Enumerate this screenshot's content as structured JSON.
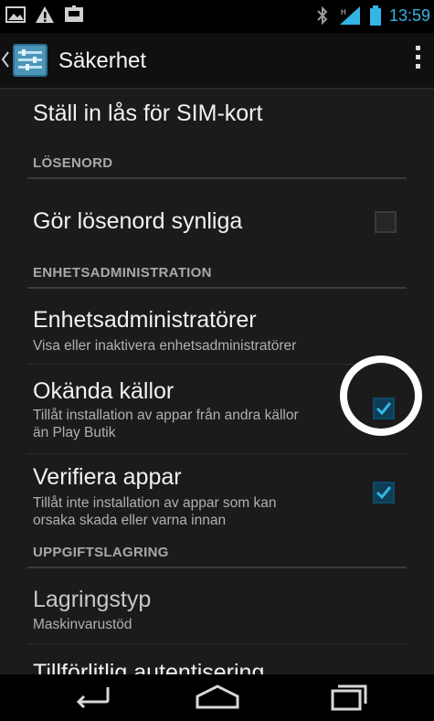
{
  "status_bar": {
    "time": "13:59",
    "left_icons": [
      "image-icon",
      "warning-icon",
      "message-icon"
    ],
    "right_icons": [
      "bluetooth-icon",
      "signal-icon",
      "battery-icon"
    ],
    "accent": "#33b5e5"
  },
  "action_bar": {
    "title": "Säkerhet",
    "icons": [
      "up-caret-icon",
      "settings-app-icon",
      "overflow-menu-icon"
    ]
  },
  "settings": {
    "sim_lock": {
      "title": "Ställ in lås för SIM-kort"
    },
    "section_password": "LÖSENORD",
    "show_password": {
      "title": "Gör lösenord synliga",
      "checked": false
    },
    "section_device_admin": "ENHETSADMINISTRATION",
    "device_admins": {
      "title": "Enhetsadministratörer",
      "summary": "Visa eller inaktivera enhetsadministratörer"
    },
    "unknown_sources": {
      "title": "Okända källor",
      "summary_line1": "Tillåt installation av appar från andra källor",
      "summary_line2": "än Play Butik",
      "checked": true
    },
    "verify_apps": {
      "title": "Verifiera appar",
      "summary_line1": "Tillåt inte installation av appar som kan",
      "summary_line2": "orsaka skada eller varna innan",
      "checked": true
    },
    "section_storage": "UPPGIFTSLAGRING",
    "storage_type": {
      "title": "Lagringstyp",
      "summary": "Maskinvarustöd"
    },
    "trusted_credentials": {
      "title": "Tillförlitlig autentisering"
    }
  },
  "nav_bar": {
    "icons": [
      "back-icon",
      "home-icon",
      "recent-apps-icon"
    ]
  },
  "colors": {
    "checkmark": "#33b5e5",
    "highlight_circle": "#ffffff",
    "background": "#1b1b1b"
  }
}
